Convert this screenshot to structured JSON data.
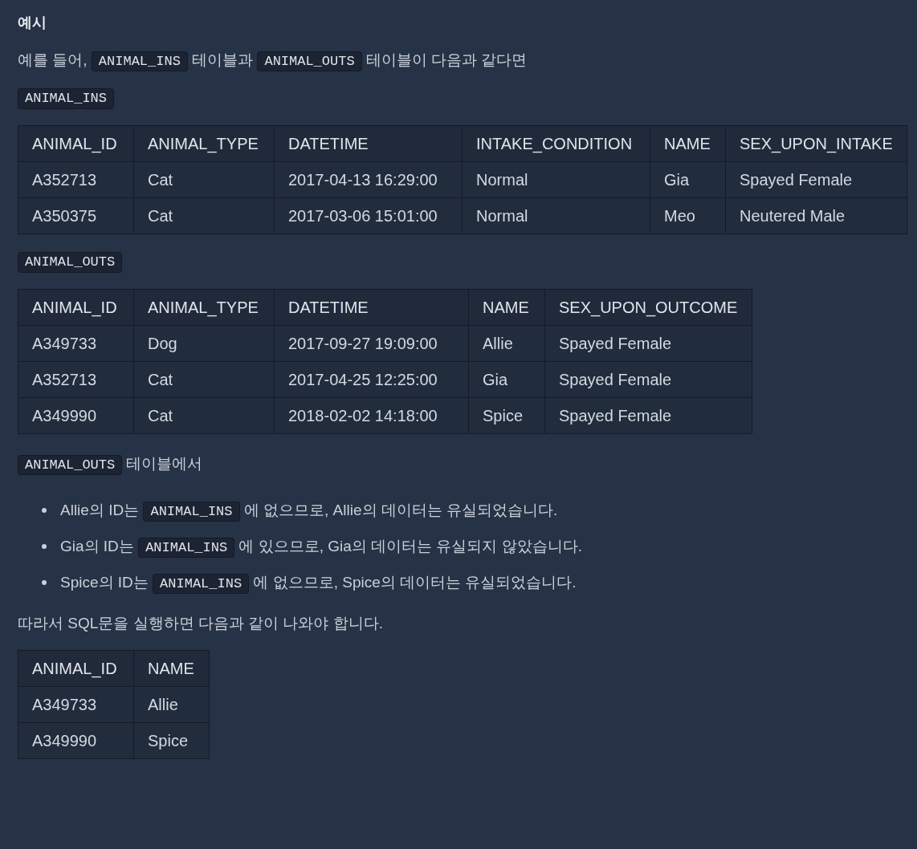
{
  "heading": "예시",
  "intro": [
    {
      "kind": "text",
      "text": "예를 들어, "
    },
    {
      "kind": "code",
      "text": "ANIMAL_INS"
    },
    {
      "kind": "text",
      "text": " 테이블과 "
    },
    {
      "kind": "code",
      "text": "ANIMAL_OUTS"
    },
    {
      "kind": "text",
      "text": " 테이블이 다음과 같다면"
    }
  ],
  "table_ins": {
    "caption": "ANIMAL_INS",
    "columns": [
      "ANIMAL_ID",
      "ANIMAL_TYPE",
      "DATETIME",
      "INTAKE_CONDITION",
      "NAME",
      "SEX_UPON_INTAKE"
    ],
    "rows": [
      [
        "A352713",
        "Cat",
        "2017-04-13 16:29:00",
        "Normal",
        "Gia",
        "Spayed Female"
      ],
      [
        "A350375",
        "Cat",
        "2017-03-06 15:01:00",
        "Normal",
        "Meo",
        "Neutered Male"
      ]
    ]
  },
  "table_outs": {
    "caption": "ANIMAL_OUTS",
    "columns": [
      "ANIMAL_ID",
      "ANIMAL_TYPE",
      "DATETIME",
      "NAME",
      "SEX_UPON_OUTCOME"
    ],
    "rows": [
      [
        "A349733",
        "Dog",
        "2017-09-27 19:09:00",
        "Allie",
        "Spayed Female"
      ],
      [
        "A352713",
        "Cat",
        "2017-04-25 12:25:00",
        "Gia",
        "Spayed Female"
      ],
      [
        "A349990",
        "Cat",
        "2018-02-02 14:18:00",
        "Spice",
        "Spayed Female"
      ]
    ]
  },
  "lead": [
    {
      "kind": "code",
      "text": "ANIMAL_OUTS"
    },
    {
      "kind": "text",
      "text": " 테이블에서"
    }
  ],
  "bullets": [
    [
      {
        "kind": "text",
        "text": "Allie의 ID는 "
      },
      {
        "kind": "code",
        "text": "ANIMAL_INS"
      },
      {
        "kind": "text",
        "text": " 에 없으므로, Allie의 데이터는 유실되었습니다."
      }
    ],
    [
      {
        "kind": "text",
        "text": "Gia의 ID는 "
      },
      {
        "kind": "code",
        "text": "ANIMAL_INS"
      },
      {
        "kind": "text",
        "text": " 에 있으므로, Gia의 데이터는 유실되지 않았습니다."
      }
    ],
    [
      {
        "kind": "text",
        "text": "Spice의 ID는 "
      },
      {
        "kind": "code",
        "text": "ANIMAL_INS"
      },
      {
        "kind": "text",
        "text": " 에 없으므로, Spice의 데이터는 유실되었습니다."
      }
    ]
  ],
  "conclusion": "따라서 SQL문을 실행하면 다음과 같이 나와야 합니다.",
  "table_result": {
    "columns": [
      "ANIMAL_ID",
      "NAME"
    ],
    "rows": [
      [
        "A349733",
        "Allie"
      ],
      [
        "A349990",
        "Spice"
      ]
    ]
  }
}
